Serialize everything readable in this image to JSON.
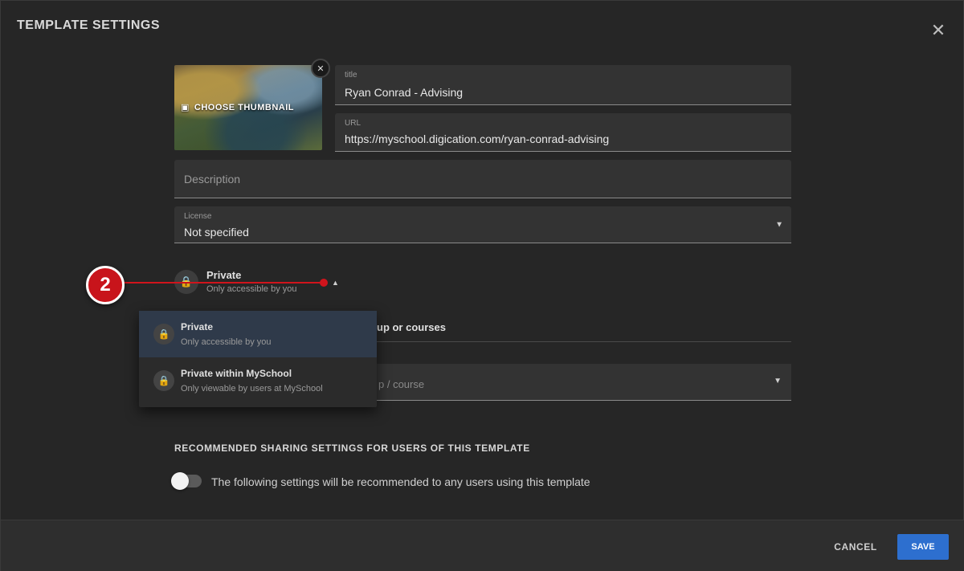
{
  "dialog": {
    "title": "TEMPLATE SETTINGS"
  },
  "thumbnail": {
    "label": "CHOOSE THUMBNAIL",
    "close_icon": "close-icon"
  },
  "fields": {
    "title_label": "title",
    "title_value": "Ryan Conrad - Advising",
    "url_label": "URL",
    "url_value": "https://myschool.digication.com/ryan-conrad-advising",
    "description_placeholder": "Description",
    "license_label": "License",
    "license_value": "Not specified"
  },
  "visibility": {
    "title": "Private",
    "subtitle": "Only accessible by you"
  },
  "callout": {
    "number": "2",
    "color": "#d0141c"
  },
  "behind": {
    "groups_text": "up or courses",
    "groups_select_placeholder": "p / course"
  },
  "menu": {
    "items": [
      {
        "title": "Private",
        "subtitle": "Only accessible by you",
        "selected": true
      },
      {
        "title": "Private within MySchool",
        "subtitle": "Only viewable by users at MySchool",
        "selected": false
      }
    ]
  },
  "sharing": {
    "heading": "RECOMMENDED SHARING SETTINGS FOR USERS OF THIS TEMPLATE",
    "toggle_label": "The following settings will be recommended to any users using this template",
    "toggle_on": false
  },
  "footer": {
    "cancel_label": "CANCEL",
    "save_label": "SAVE",
    "save_color": "#2d6fcf"
  }
}
